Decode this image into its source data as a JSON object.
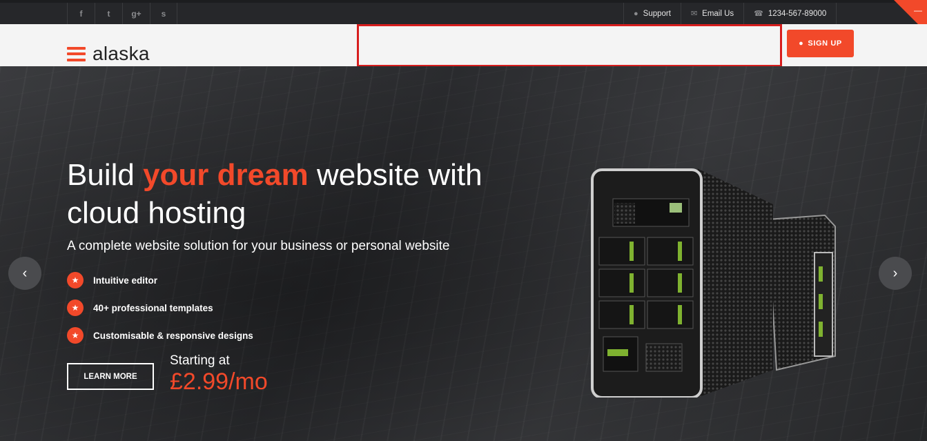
{
  "topbar": {
    "social": [
      {
        "icon": "facebook-icon",
        "glyph": "f"
      },
      {
        "icon": "twitter-icon",
        "glyph": "t"
      },
      {
        "icon": "google-plus-icon",
        "glyph": "g+"
      },
      {
        "icon": "skype-icon",
        "glyph": "s"
      }
    ],
    "support_label": "Support",
    "email_label": "Email Us",
    "phone": "1234-567-89000"
  },
  "header": {
    "logo_text": "alaska",
    "signup_label": "SIGN UP"
  },
  "hero": {
    "headline_pre": "Build ",
    "headline_highlight": "your dream",
    "headline_post": " website with cloud hosting",
    "subline": "A complete website solution for your business or personal website",
    "features": [
      "Intuitive editor",
      "40+ professional templates",
      "Customisable & responsive designs"
    ],
    "learn_more": "LEARN MORE",
    "starting_at": "Starting at",
    "price": "£2.99/mo"
  },
  "colors": {
    "accent": "#f2492a",
    "topbar": "#26272a",
    "header": "#f4f4f4"
  }
}
